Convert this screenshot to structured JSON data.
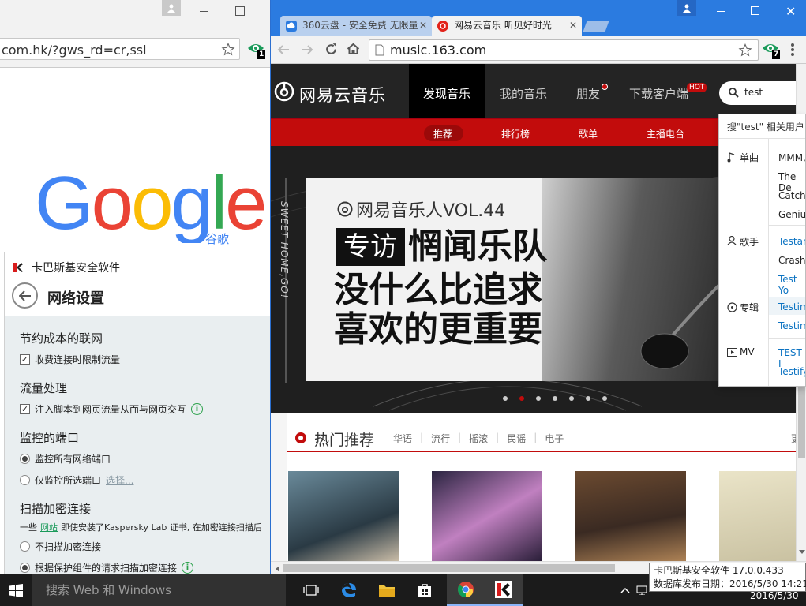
{
  "left_browser": {
    "url_fragment": "com.hk/?gws_rd=cr,ssl",
    "extension_badge": "1",
    "google_sub": "谷歌",
    "colors": {
      "blue": "#4285f4",
      "red": "#ea4335",
      "yellow": "#fbbc05",
      "green": "#34a853"
    }
  },
  "kaspersky": {
    "app_title": "卡巴斯基安全软件",
    "page_title": "网络设置",
    "sections": {
      "s1": {
        "title": "节约成本的联网",
        "cb1": "收费连接时限制流量"
      },
      "s2": {
        "title": "流量处理",
        "cb1": "注入脚本到网页流量从而与网页交互"
      },
      "s3": {
        "title": "监控的端口",
        "r1": "监控所有网络端口",
        "r2": "仅监控所选端口",
        "r2_link": "选择..."
      },
      "s4": {
        "title": "扫描加密连接",
        "desc_a": "一些",
        "desc_link": "网站",
        "desc_b": "即使安装了Kaspersky Lab 证书, 在加密连接扫描后",
        "r1": "不扫描加密连接",
        "r2": "根据保护组件的请求扫描加密连接"
      }
    }
  },
  "right_browser": {
    "tabs": [
      {
        "label": "360云盘 - 安全免费 无限量"
      },
      {
        "label": "网易云音乐 听见好时光"
      }
    ],
    "url": "music.163.com",
    "extension_badge": "7",
    "site": {
      "logo_text": "网易云音乐",
      "nav": [
        "发现音乐",
        "我的音乐",
        "朋友",
        "下载客户端"
      ],
      "hot_badge": "HOT",
      "search_value": "test",
      "subnav": [
        "推荐",
        "排行榜",
        "歌单",
        "主播电台"
      ],
      "banner": {
        "vol_text": "网易音乐人VOL.44",
        "tag": "专访",
        "band": "惘闻乐队",
        "line1": "没什么比追求",
        "line2": "喜欢的更重要",
        "side_text": "SWEET HOME,GO!"
      },
      "hot": {
        "title": "热门推荐",
        "tags": [
          "华语",
          "流行",
          "摇滚",
          "民谣",
          "电子"
        ],
        "more_partial": "更"
      }
    },
    "suggest": {
      "header": "搜\"test\" 相关用户 >",
      "categories": [
        {
          "label": "单曲",
          "items": [
            "MMM,",
            "The De",
            "Catch",
            "Genius"
          ]
        },
        {
          "label": "歌手",
          "items": [
            "Testan",
            "Crash",
            "Test Yo"
          ]
        },
        {
          "label": "专辑",
          "items": [
            "Testim",
            "Testim"
          ]
        },
        {
          "label": "MV",
          "items": [
            "TEST I",
            "Testify-"
          ]
        }
      ]
    }
  },
  "taskbar": {
    "search_placeholder": "搜索 Web 和 Windows",
    "tooltip_line1": "卡巴斯基安全软件 17.0.0.433",
    "tooltip_line2": "数据库发布日期：2016/5/30 14:21",
    "date": "2016/5/30"
  }
}
